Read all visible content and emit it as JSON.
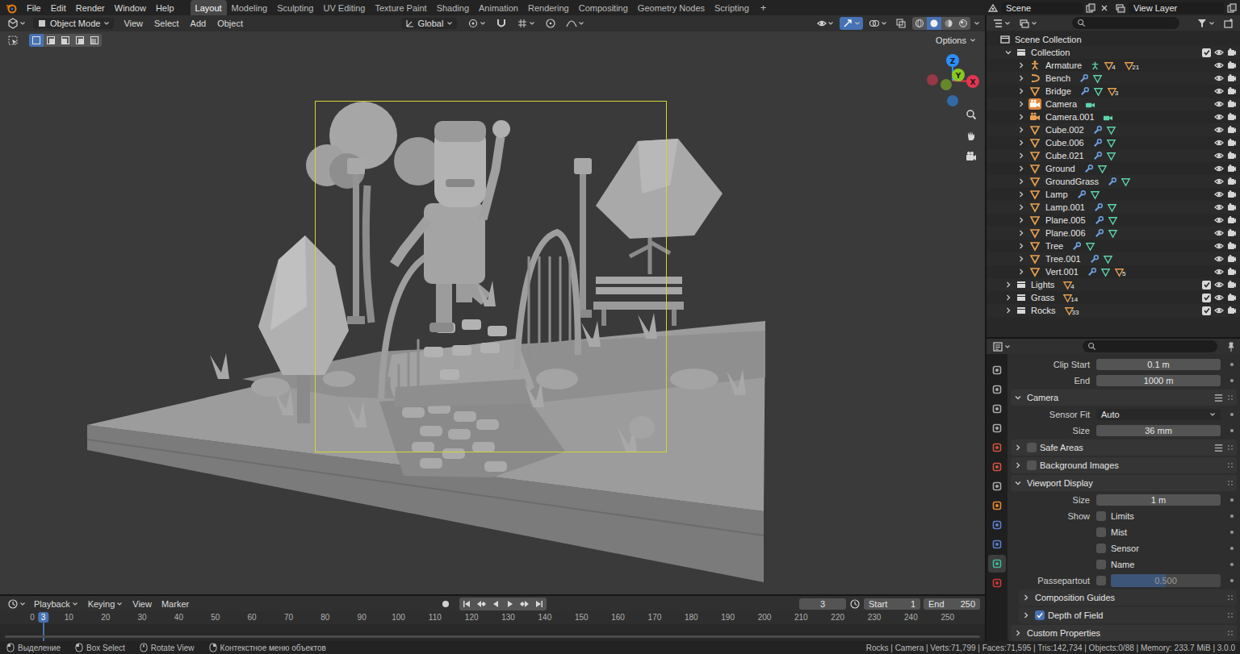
{
  "topbar": {
    "menus": [
      "File",
      "Edit",
      "Render",
      "Window",
      "Help"
    ],
    "workspaces": [
      {
        "label": "Layout",
        "selected": true
      },
      {
        "label": "Modeling",
        "selected": false
      },
      {
        "label": "Sculpting",
        "selected": false
      },
      {
        "label": "UV Editing",
        "selected": false
      },
      {
        "label": "Texture Paint",
        "selected": false
      },
      {
        "label": "Shading",
        "selected": false
      },
      {
        "label": "Animation",
        "selected": false
      },
      {
        "label": "Rendering",
        "selected": false
      },
      {
        "label": "Compositing",
        "selected": false
      },
      {
        "label": "Geometry Nodes",
        "selected": false
      },
      {
        "label": "Scripting",
        "selected": false
      }
    ],
    "add_workspace": "+",
    "scene": "Scene",
    "view_layer": "View Layer"
  },
  "viewport": {
    "mode": "Object Mode",
    "menus": [
      "View",
      "Select",
      "Add",
      "Object"
    ],
    "orientation": "Global",
    "select_modes": [
      {
        "selected": true
      },
      {
        "selected": false
      },
      {
        "selected": false
      },
      {
        "selected": false
      },
      {
        "selected": false
      }
    ],
    "shading_modes": [
      {
        "selected": false
      },
      {
        "selected": true
      },
      {
        "selected": false
      },
      {
        "selected": false
      }
    ],
    "options": "Options",
    "gizmo_axes": [
      {
        "label": "X",
        "color": "#e2364f"
      },
      {
        "label": "Y",
        "color": "#8ac721"
      },
      {
        "label": "Z",
        "color": "#2c8fff"
      }
    ]
  },
  "outliner": {
    "root": "Scene Collection",
    "collection": {
      "name": "Collection",
      "expanded": true,
      "included": true,
      "visible": true,
      "renderable": true
    },
    "objects": [
      {
        "name": "Armature",
        "kind": "armature",
        "badges": [
          "4",
          "21"
        ],
        "active": false,
        "visible": true,
        "renderable": true
      },
      {
        "name": "Bench",
        "kind": "curve",
        "badges": [],
        "active": false,
        "visible": true,
        "renderable": true
      },
      {
        "name": "Bridge",
        "kind": "mesh",
        "badges": [
          "3"
        ],
        "active": false,
        "visible": true,
        "renderable": true
      },
      {
        "name": "Camera",
        "kind": "camera",
        "badges": [],
        "active": true,
        "visible": true,
        "renderable": true
      },
      {
        "name": "Camera.001",
        "kind": "camera",
        "badges": [],
        "active": false,
        "visible": true,
        "renderable": true
      },
      {
        "name": "Cube.002",
        "kind": "mesh",
        "badges": [],
        "active": false,
        "visible": true,
        "renderable": true
      },
      {
        "name": "Cube.006",
        "kind": "mesh",
        "badges": [],
        "active": false,
        "visible": true,
        "renderable": true
      },
      {
        "name": "Cube.021",
        "kind": "mesh",
        "badges": [],
        "active": false,
        "visible": true,
        "renderable": true
      },
      {
        "name": "Ground",
        "kind": "mesh",
        "badges": [],
        "active": false,
        "visible": true,
        "renderable": true
      },
      {
        "name": "GroundGrass",
        "kind": "mesh",
        "badges": [],
        "active": false,
        "visible": true,
        "renderable": true
      },
      {
        "name": "Lamp",
        "kind": "mesh",
        "badges": [],
        "active": false,
        "visible": true,
        "renderable": true
      },
      {
        "name": "Lamp.001",
        "kind": "mesh",
        "badges": [],
        "active": false,
        "visible": true,
        "renderable": true
      },
      {
        "name": "Plane.005",
        "kind": "mesh",
        "badges": [],
        "active": false,
        "visible": true,
        "renderable": true
      },
      {
        "name": "Plane.006",
        "kind": "mesh",
        "badges": [],
        "active": false,
        "visible": true,
        "renderable": true
      },
      {
        "name": "Tree",
        "kind": "mesh",
        "badges": [],
        "active": false,
        "visible": true,
        "renderable": true
      },
      {
        "name": "Tree.001",
        "kind": "mesh",
        "badges": [],
        "active": false,
        "visible": true,
        "renderable": true
      },
      {
        "name": "Vert.001",
        "kind": "mesh",
        "badges": [
          "5"
        ],
        "active": false,
        "visible": true,
        "renderable": true
      }
    ],
    "collections": [
      {
        "name": "Lights",
        "expanded": false,
        "included": true,
        "visible": true,
        "renderable": true,
        "badge": "4"
      },
      {
        "name": "Grass",
        "expanded": false,
        "included": true,
        "visible": true,
        "renderable": true,
        "badge": "14"
      },
      {
        "name": "Rocks",
        "expanded": false,
        "included": true,
        "visible": true,
        "renderable": true,
        "badge": "33"
      }
    ]
  },
  "properties": {
    "tabs": [
      {
        "color": "#a9a9a9",
        "selected": false
      },
      {
        "color": "#a9a9a9",
        "selected": false
      },
      {
        "color": "#a9a9a9",
        "selected": false
      },
      {
        "color": "#a9a9a9",
        "selected": false
      },
      {
        "color": "#d1533f",
        "selected": false
      },
      {
        "color": "#d1533f",
        "selected": false
      },
      {
        "color": "#a9a9a9",
        "selected": false
      },
      {
        "color": "#e8872f",
        "selected": false
      },
      {
        "color": "#5a7fcf",
        "selected": false
      },
      {
        "color": "#5a7fcf",
        "selected": false
      },
      {
        "color": "#3fb896",
        "selected": true
      },
      {
        "color": "#cc3a3a",
        "selected": false
      }
    ],
    "rows": [
      {
        "kind": "field",
        "label": "Clip Start",
        "value": "0.1 m"
      },
      {
        "kind": "field",
        "label": "End",
        "value": "1000 m"
      },
      {
        "kind": "panel",
        "label": "Camera",
        "expanded": true,
        "presets": true
      },
      {
        "kind": "dropdown",
        "label": "Sensor Fit",
        "value": "Auto"
      },
      {
        "kind": "field",
        "label": "Size",
        "value": "36 mm"
      },
      {
        "kind": "panel",
        "label": "Safe Areas",
        "expanded": false,
        "presets": true,
        "checked": false
      },
      {
        "kind": "panel",
        "label": "Background Images",
        "expanded": false,
        "presets": false,
        "checked": false
      },
      {
        "kind": "panel",
        "label": "Viewport Display",
        "expanded": true,
        "presets": false
      },
      {
        "kind": "field",
        "label": "Size",
        "value": "1 m"
      },
      {
        "kind": "check",
        "label": "Show",
        "option": "Limits",
        "checked": false
      },
      {
        "kind": "check",
        "label": "",
        "option": "Mist",
        "checked": false
      },
      {
        "kind": "check",
        "label": "",
        "option": "Sensor",
        "checked": false
      },
      {
        "kind": "check",
        "label": "",
        "option": "Name",
        "checked": false
      },
      {
        "kind": "slider",
        "label": "Passepartout",
        "checked": false,
        "value": "0.500",
        "level": 0.5
      },
      {
        "kind": "subpanel",
        "label": "Composition Guides",
        "expanded": false
      },
      {
        "kind": "subpanel",
        "label": "Depth of Field",
        "expanded": false,
        "checked": true
      },
      {
        "kind": "panel",
        "label": "Custom Properties",
        "expanded": false,
        "presets": false
      }
    ]
  },
  "timeline": {
    "menus": [
      {
        "label": "Playback",
        "dropdown": true
      },
      {
        "label": "Keying",
        "dropdown": true
      },
      {
        "label": "View",
        "dropdown": false
      },
      {
        "label": "Marker",
        "dropdown": false
      }
    ],
    "auto_keying": false,
    "current_frame": "3",
    "start_label": "Start",
    "start": "1",
    "end_label": "End",
    "end": "250",
    "ticks": [
      "0",
      "10",
      "20",
      "30",
      "40",
      "50",
      "60",
      "70",
      "80",
      "90",
      "100",
      "110",
      "120",
      "130",
      "140",
      "150",
      "160",
      "170",
      "180",
      "190",
      "200",
      "210",
      "220",
      "230",
      "240",
      "250"
    ]
  },
  "status_bar": {
    "items": [
      {
        "label": "Выделение",
        "kind": "left-click"
      },
      {
        "label": "Box Select",
        "kind": "left-drag"
      },
      {
        "label": "Rotate View",
        "kind": "middle-drag"
      },
      {
        "label": "Контекстное меню объектов",
        "kind": "right-click"
      }
    ],
    "stats": "Rocks | Camera | Verts:71,799 | Faces:71,595 | Tris:142,734 | Objects:0/88 | Memory: 233.7 MiB | 3.0.0"
  }
}
